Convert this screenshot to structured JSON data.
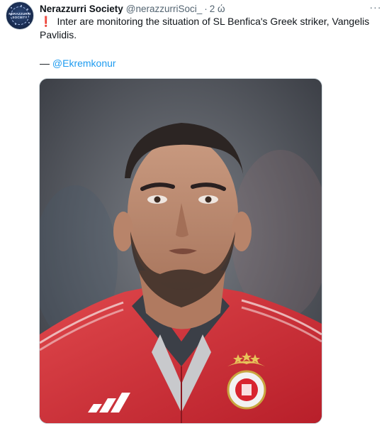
{
  "tweet": {
    "display_name": "Nerazzurri Society",
    "handle": "@nerazzurriSoci_",
    "separator": "·",
    "time": "2 ώ",
    "text": "Inter are monitoring the situation of SL Benfica's Greek striker, Vangelis Pavlidis.",
    "credit_prefix": "— ",
    "credit_mention": "@Ekremkonur",
    "more_label": "···"
  },
  "avatar": {
    "wordmark_line1": "NERAZZURRI",
    "wordmark_line2": "SOCIETY"
  },
  "icons": {
    "alert": "exclamation-icon",
    "more": "more-icon"
  },
  "colors": {
    "mention": "#1d9bf0",
    "alert": "#e0245e",
    "secondary": "#536471",
    "benfica_red": "#d8242f"
  }
}
